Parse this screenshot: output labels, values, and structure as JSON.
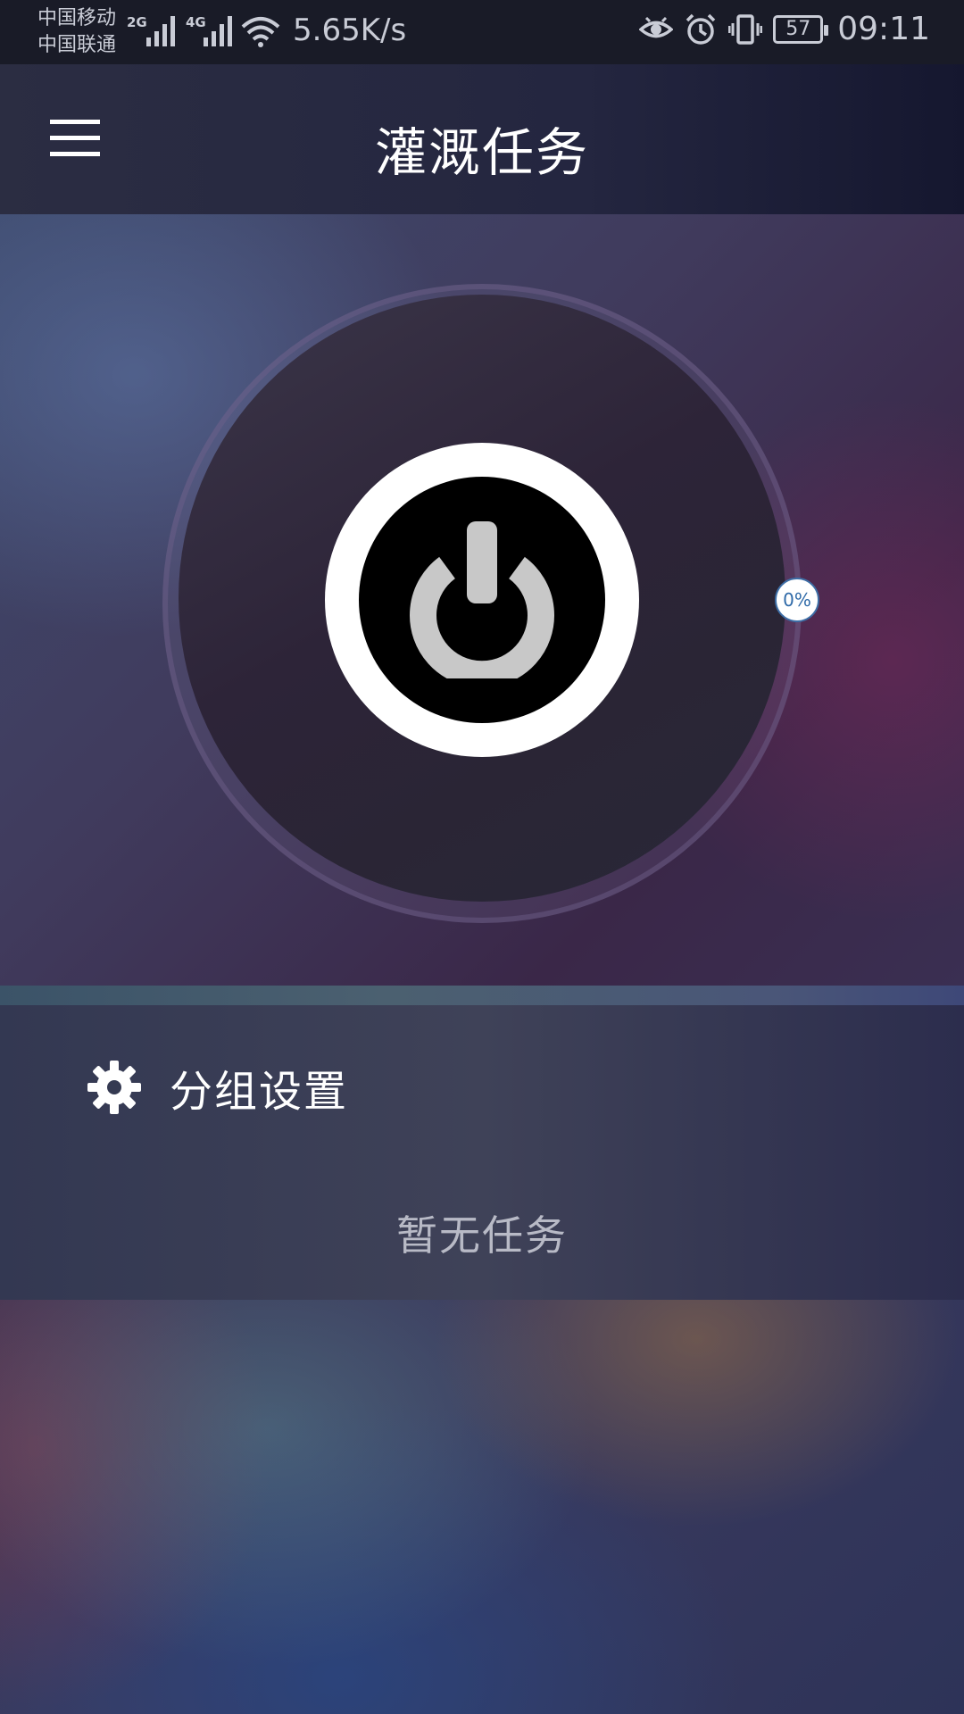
{
  "status_bar": {
    "carrier_1": "中国移动",
    "carrier_2": "中国联通",
    "network_1": "2G",
    "network_2": "4G",
    "net_speed": "5.65K/s",
    "icons": [
      "eye-icon",
      "alarm-icon",
      "vibrate-icon"
    ],
    "battery": "57",
    "time": "09:11"
  },
  "app_bar": {
    "title": "灌溉任务",
    "menu_icon": "menu-icon"
  },
  "controller": {
    "power_icon": "power-icon",
    "progress_label": "0%",
    "progress": 0
  },
  "group": {
    "icon": "gear-icon",
    "label": "分组设置"
  },
  "tasks": {
    "empty_text": "暂无任务"
  },
  "colors": {
    "power_ring": "#ffffff",
    "power_core": "#000000",
    "power_glyph": "#c8c8c8",
    "badge_text": "#2f6aa8"
  }
}
